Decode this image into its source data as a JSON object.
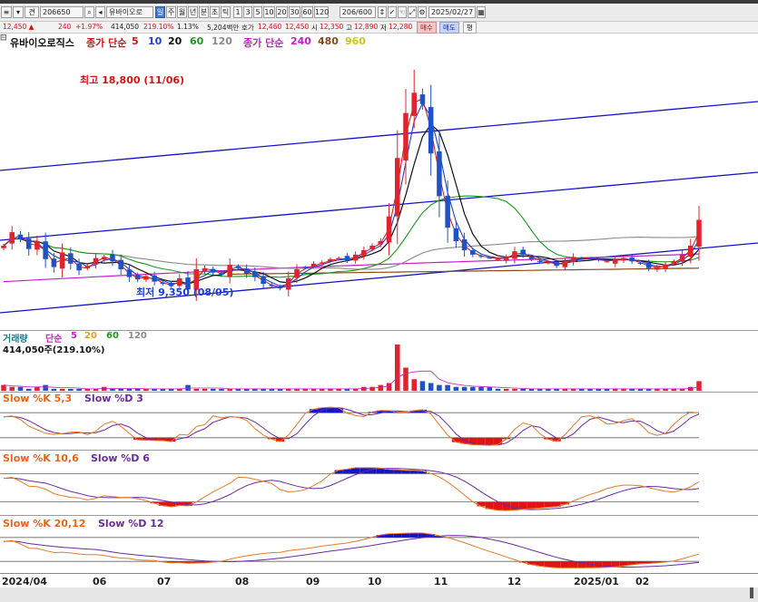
{
  "toolbar": {
    "code_prefix": "견",
    "code": "206650",
    "name": "유바이오로",
    "periods": [
      "일",
      "주",
      "월",
      "년",
      "분",
      "초",
      "틱"
    ],
    "numbers": [
      "1",
      "3",
      "5",
      "10",
      "20",
      "30",
      "60",
      "120"
    ],
    "count": "206/600",
    "date": "2025/02/27"
  },
  "info": {
    "price": "12,450 ▲",
    "change": "240",
    "change_pct": "+1.97%",
    "volume": "414,050",
    "vol_pct": "219.10%",
    "turnover": "1.13%",
    "amount": "5,204백만",
    "quote_label": "호가",
    "quote": "12,460",
    "quote2": "12,450",
    "open_label": "시",
    "open": "12,350",
    "high_label": "고",
    "high": "12,890",
    "low_label": "저",
    "low": "12,280",
    "buy": "매수",
    "sell": "매도",
    "avg": "평"
  },
  "legend": {
    "name": "유바이오로직스",
    "ma_label": "종가 단순",
    "ma_periods": [
      "5",
      "10",
      "20",
      "60",
      "120"
    ],
    "ma2_label": "종가 단순",
    "ma2_periods": [
      "240",
      "480",
      "960"
    ]
  },
  "annotations": {
    "high": "최고 18,800 (11/06)",
    "low": "최저 9,350 (08/05)"
  },
  "volume_panel": {
    "label": "거래량",
    "ma_label": "단순",
    "periods": [
      "5",
      "20",
      "60",
      "120"
    ],
    "value": "414,050주(219.10%)"
  },
  "stoch_panels": [
    {
      "k_label": "Slow %K 5,3",
      "d_label": "Slow %D 3"
    },
    {
      "k_label": "Slow %K 10,6",
      "d_label": "Slow %D 6"
    },
    {
      "k_label": "Slow %K 20,12",
      "d_label": "Slow %D 12"
    }
  ],
  "x_axis": {
    "ticks": [
      "2024/04",
      "06",
      "07",
      "08",
      "09",
      "10",
      "11",
      "12",
      "2025/01",
      "02"
    ]
  },
  "colors": {
    "up": "#e0242e",
    "down": "#1f52c8",
    "ma5": "#d21414",
    "ma10": "#1c3fd0",
    "ma20": "#111111",
    "ma60": "#1a9a1a",
    "ma120": "#8a8a8a",
    "ma240": "#c81ec8",
    "ma480": "#8a4a14",
    "ma960": "#c8c818",
    "channel": "#1414c8",
    "stoch_k": "#e87a2a",
    "stoch_d": "#6a2aa0"
  },
  "chart_data": {
    "type": "candlestick",
    "symbol": "206650",
    "name": "유바이오로직스",
    "period": "daily",
    "x_range": [
      "2024/04",
      "2025/02/27"
    ],
    "price_high": {
      "value": 18800,
      "date": "11/06"
    },
    "price_low": {
      "value": 9350,
      "date": "08/05"
    },
    "last": {
      "open": 12350,
      "high": 12890,
      "low": 12280,
      "close": 12450,
      "change": 240,
      "change_pct": 1.97,
      "volume": 414050
    },
    "close_series": [
      11300,
      11900,
      11600,
      11150,
      11500,
      10700,
      10350,
      11000,
      10500,
      10200,
      10400,
      10750,
      10800,
      10600,
      10250,
      9900,
      9800,
      9950,
      9700,
      9600,
      9500,
      9850,
      9350,
      10250,
      10300,
      10100,
      10000,
      10450,
      10300,
      10050,
      9900,
      9600,
      9500,
      9400,
      9850,
      10250,
      10300,
      10500,
      10550,
      10700,
      10750,
      10650,
      10900,
      11100,
      11300,
      11500,
      12600,
      15200,
      17200,
      18100,
      17600,
      15400,
      13500,
      12100,
      11500,
      11100,
      10900,
      10800,
      10750,
      10700,
      10800,
      11050,
      10900,
      10700,
      10600,
      10550,
      10400,
      10600,
      10800,
      10750,
      10700,
      10650,
      10600,
      10700,
      10750,
      10600,
      10500,
      10300,
      10350,
      10450,
      10600,
      10900,
      11300,
      12450
    ],
    "series": [
      {
        "name": "5",
        "type": "ma"
      },
      {
        "name": "10",
        "type": "ma"
      },
      {
        "name": "20",
        "type": "ma"
      },
      {
        "name": "60",
        "type": "ma"
      },
      {
        "name": "120",
        "type": "ma"
      },
      {
        "name": "240",
        "type": "ma"
      },
      {
        "name": "480",
        "type": "ma"
      }
    ],
    "volume_series": [
      3,
      2,
      2,
      1,
      2,
      3,
      1,
      1,
      1,
      1,
      1,
      1,
      2,
      1,
      1,
      1,
      1,
      1,
      1,
      1,
      1,
      1,
      3,
      1,
      1,
      1,
      1,
      1,
      1,
      1,
      1,
      1,
      1,
      1,
      1,
      1,
      1,
      1,
      1,
      1,
      1,
      1,
      1,
      2,
      2,
      3,
      4,
      24,
      12,
      6,
      5,
      4,
      3,
      3,
      2,
      2,
      2,
      2,
      2,
      1,
      1,
      1,
      1,
      1,
      1,
      1,
      1,
      1,
      1,
      1,
      1,
      1,
      1,
      1,
      1,
      1,
      1,
      1,
      1,
      1,
      1,
      1,
      2,
      5
    ]
  }
}
